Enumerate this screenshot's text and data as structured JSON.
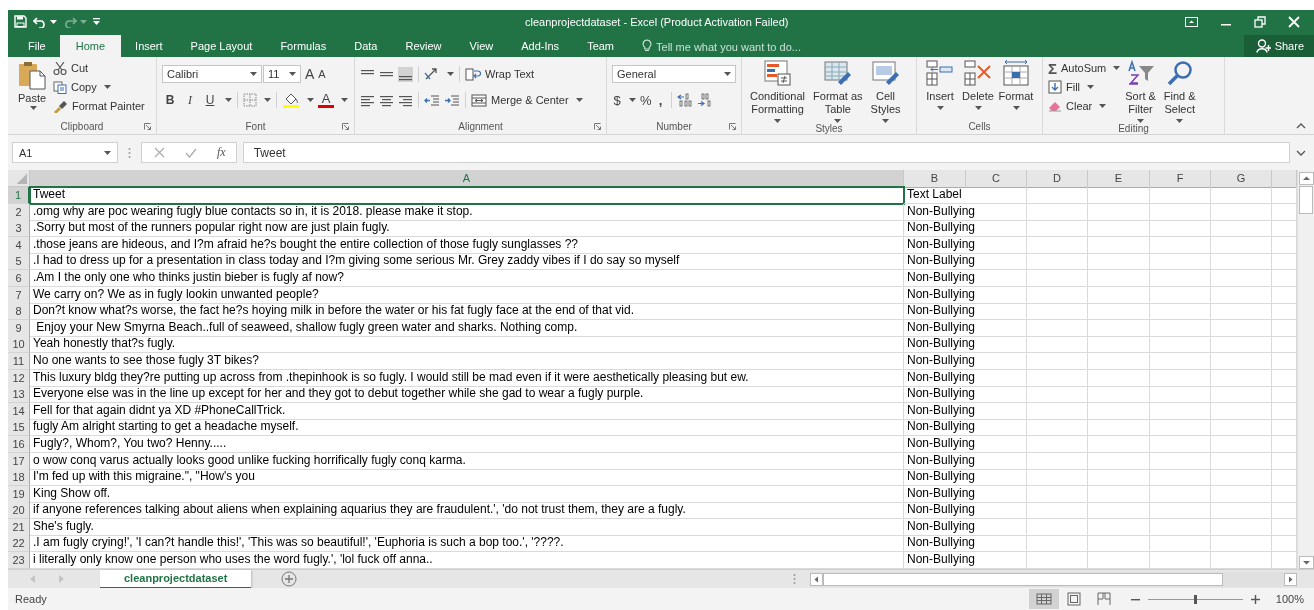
{
  "window": {
    "title": "cleanprojectdataset - Excel (Product Activation Failed)"
  },
  "ribbon_tabs": [
    {
      "label": "File",
      "selected": false
    },
    {
      "label": "Home",
      "selected": true
    },
    {
      "label": "Insert",
      "selected": false
    },
    {
      "label": "Page Layout",
      "selected": false
    },
    {
      "label": "Formulas",
      "selected": false
    },
    {
      "label": "Data",
      "selected": false
    },
    {
      "label": "Review",
      "selected": false
    },
    {
      "label": "View",
      "selected": false
    },
    {
      "label": "Add-Ins",
      "selected": false
    },
    {
      "label": "Team",
      "selected": false
    }
  ],
  "tell_me": {
    "placeholder": "Tell me what you want to do..."
  },
  "share_button": "Share",
  "clipboard": {
    "name": "Clipboard",
    "paste": "Paste",
    "cut": "Cut",
    "copy": "Copy",
    "format_painter": "Format Painter"
  },
  "font": {
    "name": "Font",
    "font_name": "Calibri",
    "font_size": "11",
    "grow": "A",
    "shrink": "A",
    "bold": "B",
    "italic": "I",
    "underline": "U",
    "font_color": "A"
  },
  "alignment": {
    "name": "Alignment",
    "wrap_text": "Wrap Text",
    "merge_center": "Merge & Center"
  },
  "number": {
    "name": "Number",
    "format": "General",
    "currency": "$",
    "percent": "%",
    "comma": ","
  },
  "styles": {
    "name": "Styles",
    "buttons": [
      [
        "Conditional",
        "Formatting"
      ],
      [
        "Format as",
        "Table"
      ],
      [
        "Cell",
        "Styles"
      ]
    ]
  },
  "cells": {
    "name": "Cells",
    "buttons": [
      "Insert",
      "Delete",
      "Format"
    ]
  },
  "editing": {
    "name": "Editing",
    "autosum_symbol": "Σ",
    "autosum": "AutoSum",
    "fill": "Fill",
    "clear": "Clear",
    "sort_filter": [
      "Sort &",
      "Filter"
    ],
    "find_select": [
      "Find &",
      "Select"
    ]
  },
  "formula_bar": {
    "name_box": "A1",
    "fx": "fx",
    "formula": "Tweet"
  },
  "columns": [
    {
      "label": "A",
      "selected": true
    },
    {
      "label": "B",
      "selected": false
    },
    {
      "label": "C",
      "selected": false
    },
    {
      "label": "D",
      "selected": false
    },
    {
      "label": "E",
      "selected": false
    },
    {
      "label": "F",
      "selected": false
    },
    {
      "label": "G",
      "selected": false
    }
  ],
  "rows": [
    {
      "number": "1",
      "selected": true,
      "cells": [
        "Tweet",
        "Text Label"
      ]
    },
    {
      "number": "2",
      "selected": false,
      "cells": [
        ".omg why are poc wearing fugly blue contacts so in, it is 2018. please make it stop.",
        "Non-Bullying"
      ]
    },
    {
      "number": "3",
      "selected": false,
      "cells": [
        ".Sorry but most of the runners popular right now are just plain fugly.",
        "Non-Bullying"
      ]
    },
    {
      "number": "4",
      "selected": false,
      "cells": [
        ".those jeans are hideous, and I?m afraid he?s bought the entire collection of those fugly sunglasses ??",
        "Non-Bullying"
      ]
    },
    {
      "number": "5",
      "selected": false,
      "cells": [
        ".I had to dress up for a presentation in class today and I?m giving some serious Mr. Grey zaddy vibes if I do say so myself",
        "Non-Bullying"
      ]
    },
    {
      "number": "6",
      "selected": false,
      "cells": [
        ".Am I the only one who thinks justin bieber is fugly af now?",
        "Non-Bullying"
      ]
    },
    {
      "number": "7",
      "selected": false,
      "cells": [
        "We carry on? We as in fugly lookin unwanted people?",
        "Non-Bullying"
      ]
    },
    {
      "number": "8",
      "selected": false,
      "cells": [
        "Don?t know what?s worse, the fact he?s hoying milk in before the water or his fat fugly face at the end of that vid.",
        "Non-Bullying"
      ]
    },
    {
      "number": "9",
      "selected": false,
      "cells": [
        " Enjoy your New Smyrna Beach..full of seaweed, shallow fugly green water and sharks. Nothing comp.",
        "Non-Bullying"
      ]
    },
    {
      "number": "10",
      "selected": false,
      "cells": [
        "Yeah honestly that?s fugly.",
        "Non-Bullying"
      ]
    },
    {
      "number": "11",
      "selected": false,
      "cells": [
        "No one wants to see those fugly 3T bikes?",
        "Non-Bullying"
      ]
    },
    {
      "number": "12",
      "selected": false,
      "cells": [
        "This luxury bldg they?re putting up across from .thepinhook is so fugly. I would still be mad even if it were aesthetically pleasing but ew.",
        "Non-Bullying"
      ]
    },
    {
      "number": "13",
      "selected": false,
      "cells": [
        "Everyone else was in the line up except for her and they got to debut together while she gad to wear a fugly purple.",
        "Non-Bullying"
      ]
    },
    {
      "number": "14",
      "selected": false,
      "cells": [
        "Fell for that again didnt ya XD #PhoneCallTrick.",
        "Non-Bullying"
      ]
    },
    {
      "number": "15",
      "selected": false,
      "cells": [
        "fugly Am alright starting to get a headache myself.",
        "Non-Bullying"
      ]
    },
    {
      "number": "16",
      "selected": false,
      "cells": [
        "Fugly?, Whom?, You two? Henny.....",
        "Non-Bullying"
      ]
    },
    {
      "number": "17",
      "selected": false,
      "cells": [
        "o wow conq varus actually looks good unlike fucking horrifically fugly conq karma.",
        "Non-Bullying"
      ]
    },
    {
      "number": "18",
      "selected": false,
      "cells": [
        "I'm fed up with this migraine.\", \"How's you",
        "Non-Bullying"
      ]
    },
    {
      "number": "19",
      "selected": false,
      "cells": [
        "King Show off.",
        "Non-Bullying"
      ]
    },
    {
      "number": "20",
      "selected": false,
      "cells": [
        "if anyone references talking about aliens when explaining aquarius they are fraudulent.', 'do not trust them, they are a fugly.",
        "Non-Bullying"
      ]
    },
    {
      "number": "21",
      "selected": false,
      "cells": [
        "She's fugly.",
        "Non-Bullying"
      ]
    },
    {
      "number": "22",
      "selected": false,
      "cells": [
        ".I am fugly crying!', 'I can?t handle this!', 'This was so beautiful!', 'Euphoria is such a bop too.', '????.",
        "Non-Bullying"
      ]
    },
    {
      "number": "23",
      "selected": false,
      "cells": [
        "i literally only know one person who uses the word fugly.', 'lol fuck off anna..",
        "Non-Bullying"
      ]
    }
  ],
  "sheet_tabs": [
    {
      "label": "cleanprojectdataset",
      "selected": true
    }
  ],
  "status_bar": {
    "status": "Ready",
    "view_buttons": [
      {
        "selected": true
      },
      {
        "selected": false
      },
      {
        "selected": false
      }
    ],
    "zoom": "100%",
    "zoom_level": {
      "level": 0.5
    }
  }
}
